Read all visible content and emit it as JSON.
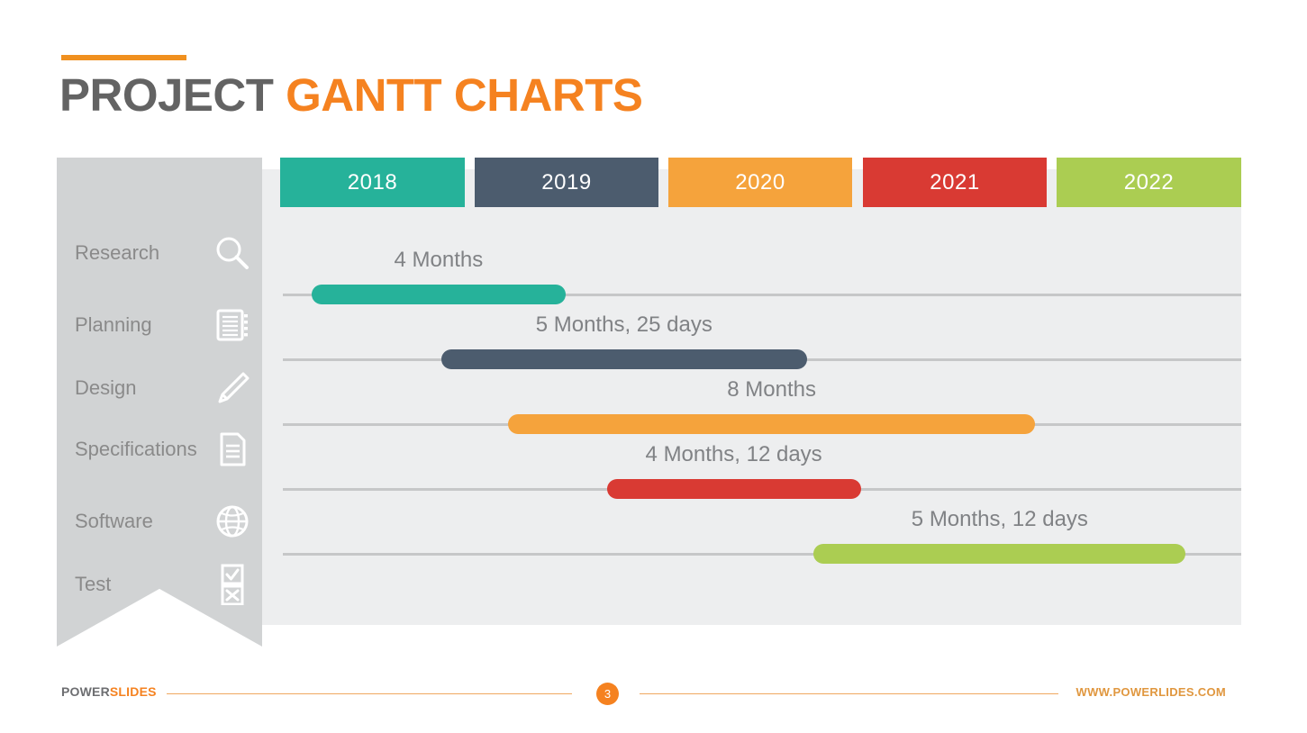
{
  "title": {
    "part1": "PROJECT",
    "part2": "GANTT CHARTS"
  },
  "colors": {
    "accent": "#f58220",
    "teal": "#26b29a",
    "slate": "#4c5c6e",
    "orange": "#f5a33c",
    "red": "#d93a33",
    "green": "#abcd52",
    "sidebar": "#d1d3d4",
    "panel": "#edeeef",
    "gridline": "#c6c7c8",
    "label_text": "#808285"
  },
  "sidebar": {
    "items": [
      {
        "label": "Research",
        "icon": "search-icon"
      },
      {
        "label": "Planning",
        "icon": "notebook-icon"
      },
      {
        "label": "Design",
        "icon": "pencil-icon"
      },
      {
        "label": "Specifications",
        "icon": "document-icon"
      },
      {
        "label": "Software",
        "icon": "globe-icon"
      },
      {
        "label": "Test",
        "icon": "checkbox-xbox-icon"
      }
    ]
  },
  "timeline": {
    "years": [
      {
        "label": "2018",
        "color": "#26b29a"
      },
      {
        "label": "2019",
        "color": "#4c5c6e"
      },
      {
        "label": "2020",
        "color": "#f5a33c"
      },
      {
        "label": "2021",
        "color": "#d93a33"
      },
      {
        "label": "2022",
        "color": "#abcd52"
      }
    ]
  },
  "footer": {
    "brand_part1": "POWER",
    "brand_part2": "SLIDES",
    "page": "3",
    "url": "WWW.POWERLIDES.COM"
  },
  "chart_data": {
    "type": "bar",
    "title": "PROJECT GANTT CHARTS",
    "orientation": "horizontal",
    "xlabel": "",
    "ylabel": "",
    "axis_categories": [
      "2018",
      "2019",
      "2020",
      "2021",
      "2022"
    ],
    "categories": [
      "Research",
      "Planning",
      "Design",
      "Specifications",
      "Software",
      "Test"
    ],
    "legend_position": "top",
    "grid": true,
    "tasks": [
      {
        "name": "Research",
        "duration_label": "4 Months",
        "months": 4,
        "days": 0,
        "color": "#26b29a",
        "start_pct": 3.0,
        "width_pct": 26.5
      },
      {
        "name": "Planning",
        "duration_label": "5 Months, 25 days",
        "months": 5,
        "days": 25,
        "color": "#4c5c6e",
        "start_pct": 16.5,
        "width_pct": 38.2
      },
      {
        "name": "Design",
        "duration_label": "8 Months",
        "months": 8,
        "days": 0,
        "color": "#f5a33c",
        "start_pct": 23.5,
        "width_pct": 55.0
      },
      {
        "name": "Specifications",
        "duration_label": "4 Months, 12 days",
        "months": 4,
        "days": 12,
        "color": "#d93a33",
        "start_pct": 33.8,
        "width_pct": 26.5
      },
      {
        "name": "Software",
        "duration_label": "5 Months, 12 days",
        "months": 5,
        "days": 12,
        "color": "#abcd52",
        "start_pct": 55.4,
        "width_pct": 38.8
      }
    ]
  }
}
